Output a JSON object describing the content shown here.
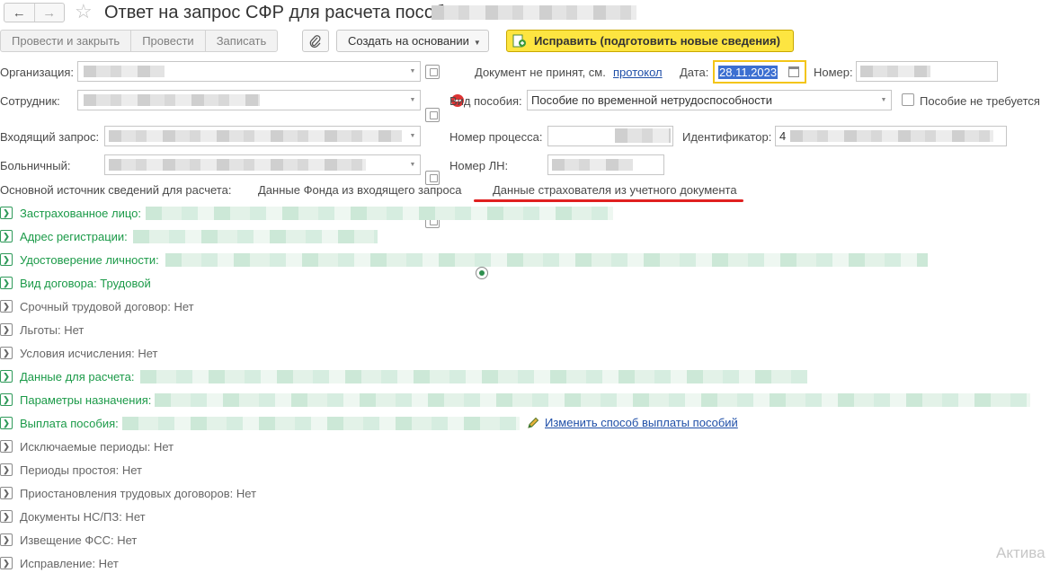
{
  "window": {
    "title": "Ответ на запрос СФР для расчета пособия"
  },
  "toolbar": {
    "post_close": "Провести и закрыть",
    "post": "Провести",
    "save": "Записать",
    "create_based": "Создать на основании",
    "fix": "Исправить (подготовить новые сведения)"
  },
  "form": {
    "org_label": "Организация:",
    "employee_label": "Сотрудник:",
    "incoming_label": "Входящий запрос:",
    "sick_label": "Больничный:",
    "status_text": "Документ не принят, см.",
    "status_link": "протокол",
    "date_label": "Дата:",
    "date_value": "28.11.2023",
    "number_label": "Номер:",
    "benefit_type_label": "Вид пособия:",
    "benefit_type_value": "Пособие по временной нетрудоспособности",
    "benefit_not_required": "Пособие не требуется",
    "process_number_label": "Номер процесса:",
    "identifier_label": "Идентификатор:",
    "identifier_value_prefix": "4",
    "ln_number_label": "Номер ЛН:",
    "source_label": "Основной источник сведений для расчета:",
    "source_option_1": "Данные Фонда из входящего запроса",
    "source_option_2": "Данные страхователя из учетного документа"
  },
  "groups": [
    {
      "label": "Застрахованное лицо:",
      "style": "green"
    },
    {
      "label": "Адрес регистрации:",
      "style": "green"
    },
    {
      "label": "Удостоверение личности:",
      "style": "green"
    },
    {
      "label": "Вид договора: Трудовой",
      "style": "green"
    },
    {
      "label": "Срочный трудовой договор: Нет",
      "style": "gray"
    },
    {
      "label": "Льготы: Нет",
      "style": "gray"
    },
    {
      "label": "Условия исчисления: Нет",
      "style": "gray"
    },
    {
      "label": "Данные для расчета:",
      "style": "green"
    },
    {
      "label": "Параметры назначения:",
      "style": "green"
    },
    {
      "label": "Выплата пособия:",
      "style": "green"
    },
    {
      "label": "Исключаемые периоды: Нет",
      "style": "gray"
    },
    {
      "label": "Периоды простоя: Нет",
      "style": "gray"
    },
    {
      "label": "Приостановления трудовых договоров: Нет",
      "style": "gray"
    },
    {
      "label": "Документы НС/ПЗ: Нет",
      "style": "gray"
    },
    {
      "label": "Извещение ФСС: Нет",
      "style": "gray"
    },
    {
      "label": "Исправление: Нет",
      "style": "gray"
    }
  ],
  "payment_link": "Изменить способ выплаты пособий",
  "watermark": "Актива",
  "colors": {
    "accent_yellow": "#fde541",
    "group_green": "#1b9a48",
    "link_blue": "#1f4fa8",
    "annotation_red": "#e02020"
  }
}
